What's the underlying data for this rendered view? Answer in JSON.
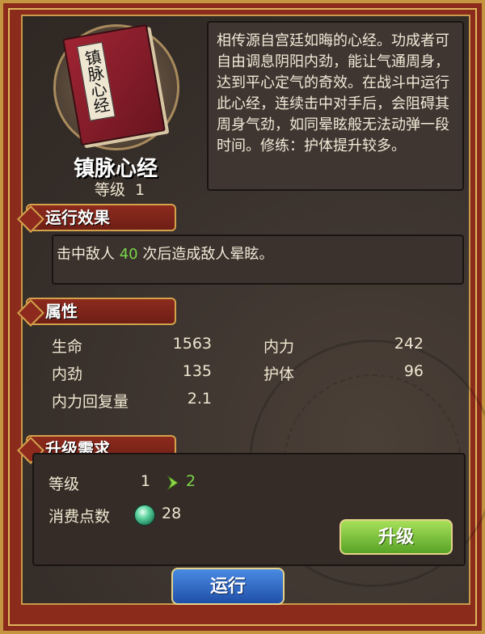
{
  "skill": {
    "book_label": "镇脉心经",
    "name": "镇脉心经",
    "level_label": "等级",
    "level_value": "1",
    "description": "相传源自宫廷如晦的心经。功成者可自由调息阴阳内劲，能让气通周身，达到平心定气的奇效。在战斗中运行此心经，连续击中对手后，会阻碍其周身气劲，如同晕眩般无法动弹一段时间。修练：护体提升较多。"
  },
  "effect": {
    "title": "运行效果",
    "text_before": "击中敌人 ",
    "count": "40",
    "text_after": " 次后造成敌人晕眩。"
  },
  "attributes": {
    "title": "属性",
    "items": [
      {
        "label": "生命",
        "value": "1563"
      },
      {
        "label": "内力",
        "value": "242"
      },
      {
        "label": "内劲",
        "value": "135"
      },
      {
        "label": "护体",
        "value": "96"
      },
      {
        "label": "内力回复量",
        "value": "2.1"
      }
    ]
  },
  "upgrade": {
    "title": "升级需求",
    "level_label": "等级",
    "level_from": "1",
    "level_to": "2",
    "cost_label": "消费点数",
    "cost_value": "28",
    "button_label": "升级"
  },
  "run_button_label": "运行",
  "icons": {
    "arrow": "chevron-right-icon",
    "gem": "gem-icon",
    "book": "book-icon"
  },
  "colors": {
    "highlight_green": "#7ad64a",
    "frame_red": "#8a2b1c",
    "gold": "#d3a24b"
  }
}
